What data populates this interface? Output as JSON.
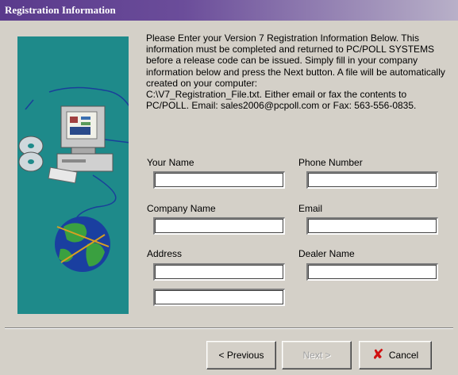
{
  "window": {
    "title": "Registration Information"
  },
  "instructions": "Please Enter your Version 7 Registration Information Below.  This information must be completed and returned to PC/POLL SYSTEMS before a release code can be issued.  Simply fill in your company information below and press the Next button.  A file will be automatically created on your computer:\nC:\\V7_Registration_File.txt.  Either email or fax the contents to PC/POLL.  Email: sales2006@pcpoll.com or Fax: 563-556-0835.",
  "fields": {
    "your_name": {
      "label": "Your Name",
      "value": ""
    },
    "phone_number": {
      "label": "Phone Number",
      "value": ""
    },
    "company_name": {
      "label": "Company Name",
      "value": ""
    },
    "email": {
      "label": "Email",
      "value": ""
    },
    "address": {
      "label": "Address",
      "value_line1": "",
      "value_line2": ""
    },
    "dealer_name": {
      "label": "Dealer Name",
      "value": ""
    }
  },
  "buttons": {
    "previous": "< Previous",
    "next": "Next >",
    "cancel": "Cancel"
  },
  "colors": {
    "title_gradient_start": "#5a3a8c",
    "art_background": "#1e8a8a",
    "cancel_icon": "#d01010"
  },
  "icons": [
    "computer-icon",
    "cd-icon",
    "globe-icon",
    "cancel-x-icon"
  ]
}
